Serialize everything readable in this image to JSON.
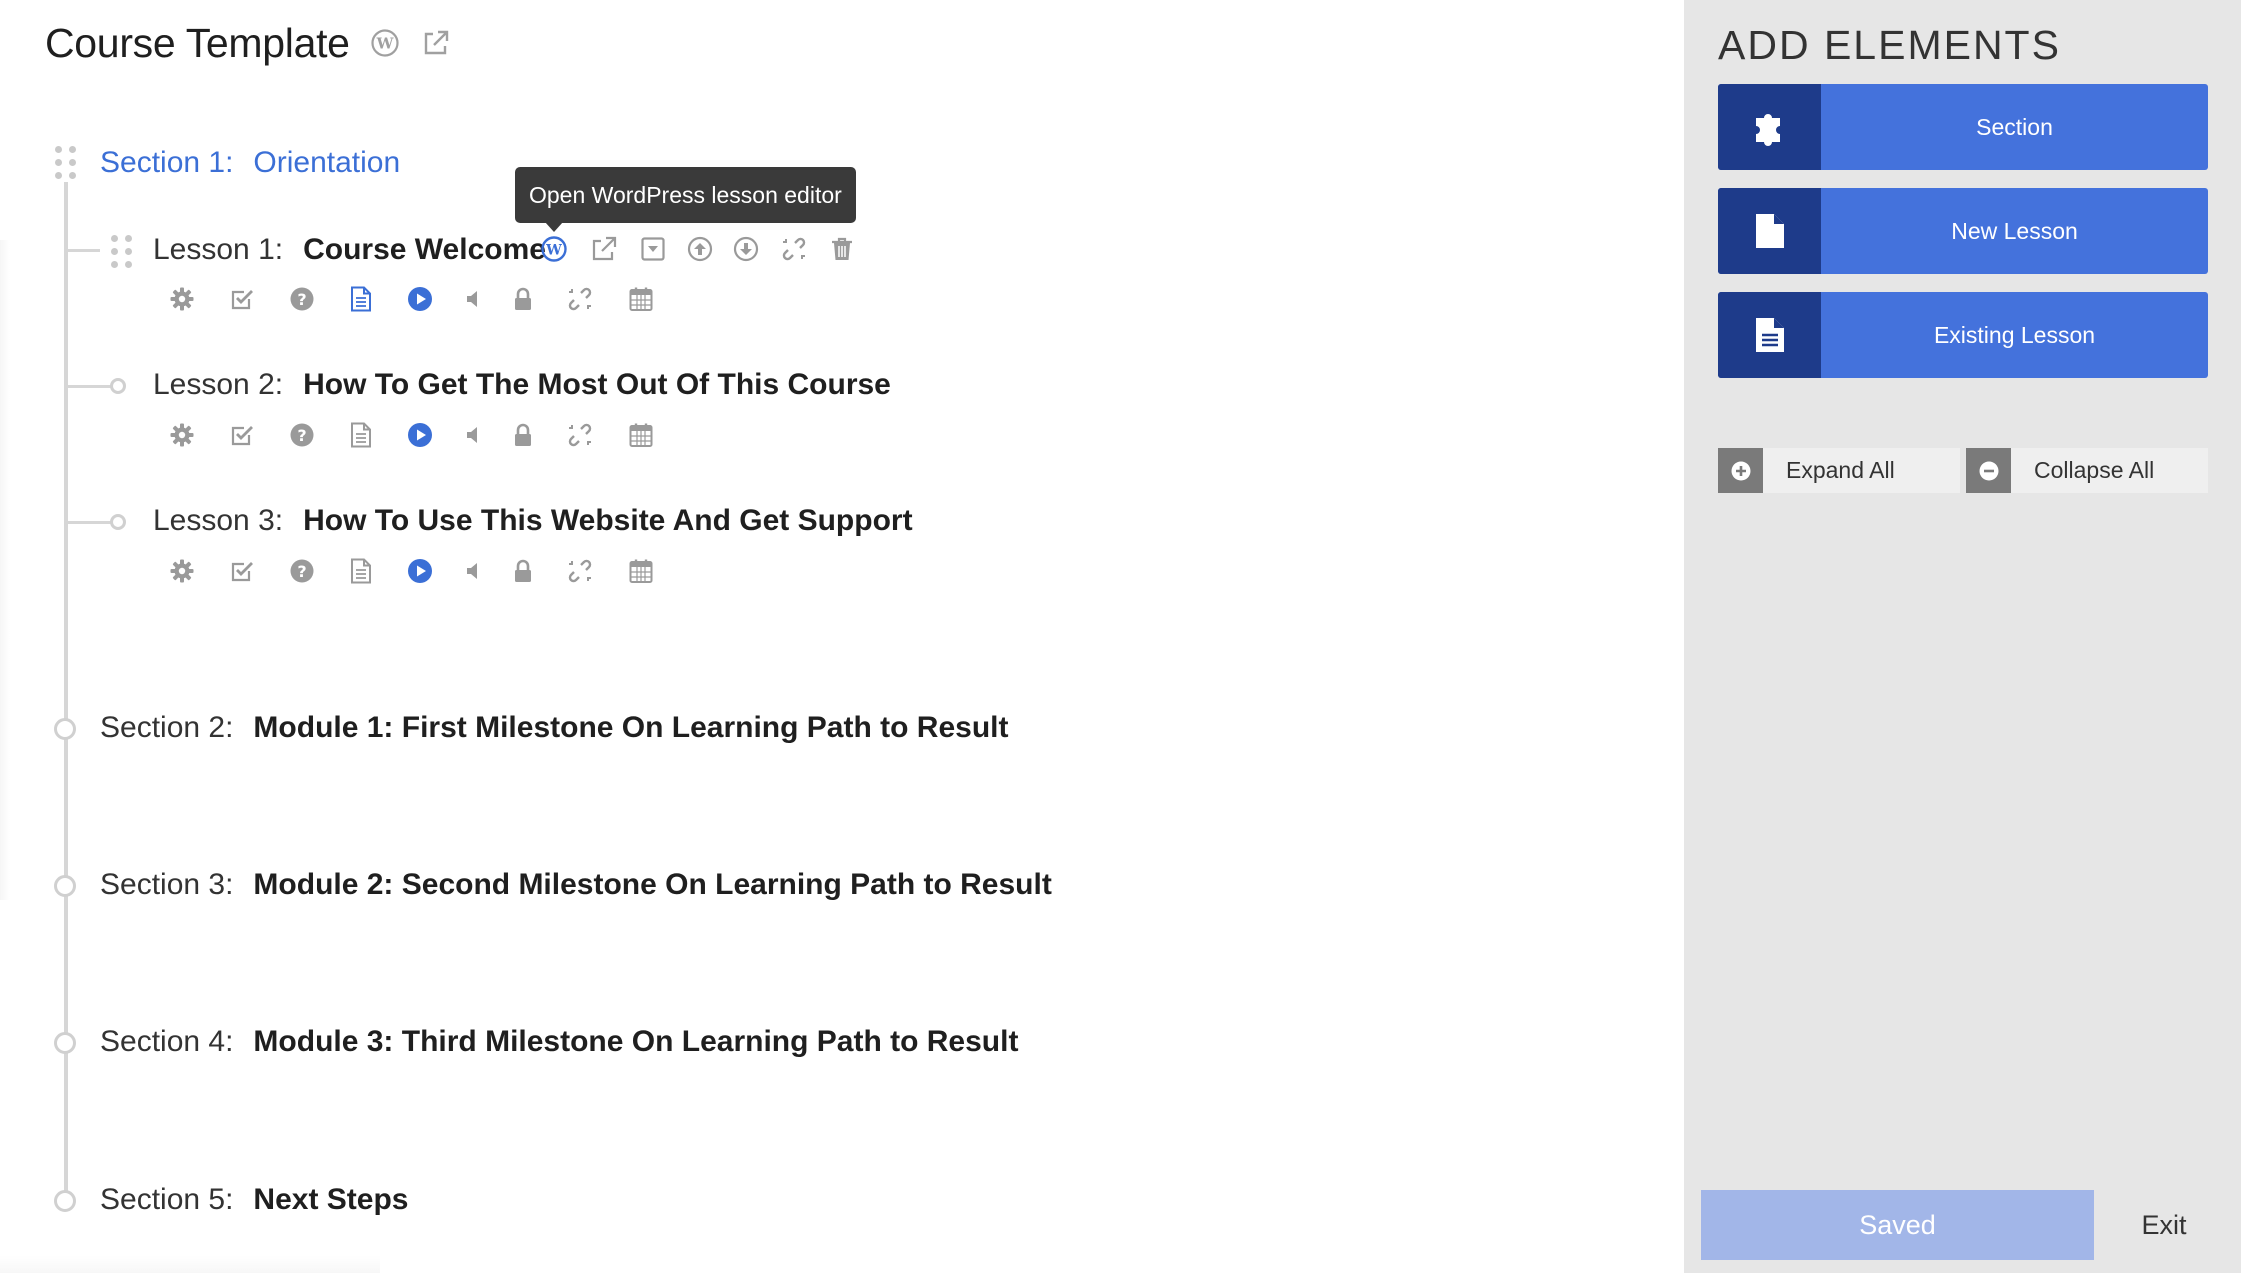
{
  "header": {
    "title": "Course Template",
    "icons": [
      "wordpress-icon",
      "external-link-icon"
    ]
  },
  "tooltip": {
    "text": "Open WordPress lesson editor"
  },
  "sections": [
    {
      "prefix": "Section 1:",
      "name": "Orientation",
      "active": true,
      "lessons": [
        {
          "prefix": "Lesson 1:",
          "name": "Course Welcome"
        },
        {
          "prefix": "Lesson 2:",
          "name": "How To Get The Most Out Of This Course"
        },
        {
          "prefix": "Lesson 3:",
          "name": "How To Use This Website And Get Support"
        }
      ]
    },
    {
      "prefix": "Section 2:",
      "name": "Module 1: First Milestone On Learning Path to Result"
    },
    {
      "prefix": "Section 3:",
      "name": "Module 2: Second Milestone On Learning Path to Result"
    },
    {
      "prefix": "Section 4:",
      "name": "Module 3: Third Milestone On Learning Path to Result"
    },
    {
      "prefix": "Section 5:",
      "name": "Next Steps"
    }
  ],
  "lesson_icons": [
    "gear-icon",
    "checkbox-icon",
    "question-icon",
    "document-icon",
    "play-icon",
    "audio-icon",
    "lock-icon",
    "unlink-icon",
    "calendar-icon"
  ],
  "lesson_action_icons": [
    "wordpress-icon",
    "external-link-icon",
    "collapse-icon",
    "move-up-icon",
    "move-down-icon",
    "unlink-icon",
    "trash-icon"
  ],
  "sidebar": {
    "heading": "ADD ELEMENTS",
    "add_buttons": [
      {
        "label": "Section",
        "icon": "puzzle-icon"
      },
      {
        "label": "New Lesson",
        "icon": "blank-page-icon"
      },
      {
        "label": "Existing Lesson",
        "icon": "text-page-icon"
      }
    ],
    "expand_label": "Expand All",
    "collapse_label": "Collapse All",
    "saved_label": "Saved",
    "exit_label": "Exit"
  },
  "colors": {
    "accent": "#4472dc",
    "accent_dark": "#1e3b8a",
    "active_text": "#3b6fd6",
    "icon_gray": "#9a9a9a",
    "sidebar_bg": "#e6e6e6",
    "saved_bg": "#a2b6e8"
  }
}
